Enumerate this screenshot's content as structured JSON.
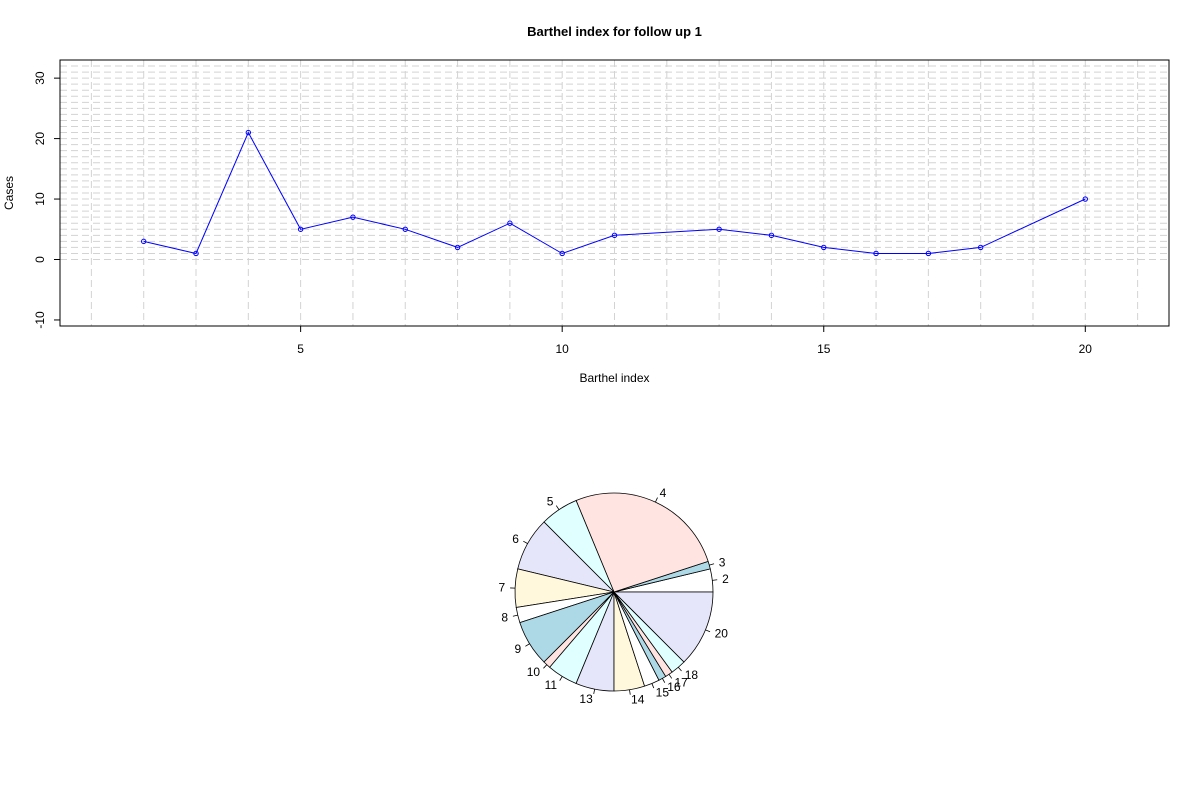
{
  "chart_data": [
    {
      "type": "line",
      "title": "Barthel index for follow up 1",
      "xlabel": "Barthel index",
      "ylabel": "Cases",
      "xlim": [
        0.4,
        21.6
      ],
      "ylim": [
        -11,
        33
      ],
      "x_ticks": [
        5,
        10,
        15,
        20
      ],
      "y_ticks": [
        -10,
        0,
        10,
        20,
        30
      ],
      "grid": true,
      "colors": {
        "line": "#0000ff",
        "grid": "#d3d3d3",
        "axis": "#000000"
      },
      "series": [
        {
          "x": [
            2,
            3,
            4,
            5,
            6,
            7,
            8,
            9,
            10,
            11,
            13,
            14,
            15,
            16,
            17,
            18,
            20
          ],
          "y": [
            3,
            1,
            21,
            5,
            7,
            5,
            2,
            6,
            1,
            4,
            5,
            4,
            2,
            1,
            1,
            2,
            10
          ]
        }
      ]
    },
    {
      "type": "pie",
      "labels": [
        "2",
        "3",
        "4",
        "5",
        "6",
        "7",
        "8",
        "9",
        "10",
        "11",
        "13",
        "14",
        "15",
        "16",
        "17",
        "18",
        "20"
      ],
      "values": [
        3,
        1,
        21,
        5,
        7,
        5,
        2,
        6,
        1,
        4,
        5,
        4,
        2,
        1,
        1,
        2,
        10
      ],
      "colors": [
        "#ffffff",
        "#add8e6",
        "#ffe4e1",
        "#e0ffff",
        "#e6e6fa",
        "#fff8dc",
        "#ffffff",
        "#add8e6",
        "#ffe4e1",
        "#e0ffff",
        "#e6e6fa",
        "#fff8dc",
        "#ffffff",
        "#add8e6",
        "#ffe4e1",
        "#e0ffff",
        "#e6e6fa"
      ]
    }
  ]
}
